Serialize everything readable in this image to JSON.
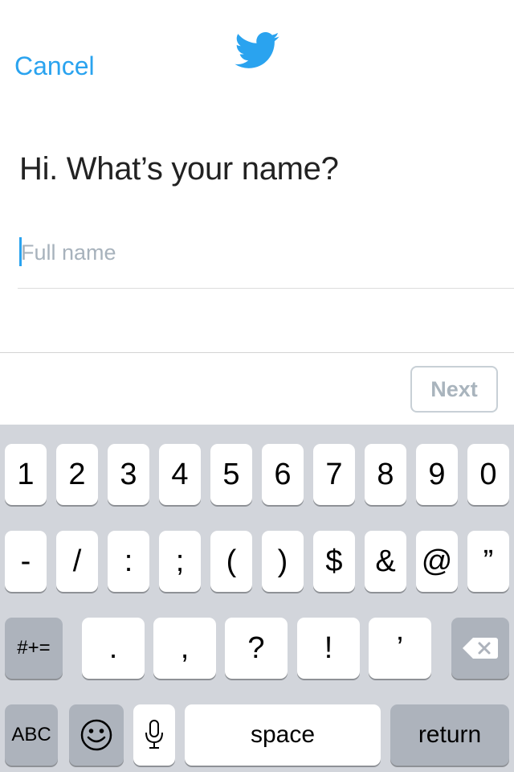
{
  "header": {
    "cancel_label": "Cancel",
    "logo_icon": "twitter-bird-icon",
    "accent_color": "#2aa3ef"
  },
  "main": {
    "heading": "Hi. What’s your name?",
    "name_placeholder": "Full name"
  },
  "action_bar": {
    "next_label": "Next"
  },
  "keyboard": {
    "row1": [
      "1",
      "2",
      "3",
      "4",
      "5",
      "6",
      "7",
      "8",
      "9",
      "0"
    ],
    "row2": [
      "-",
      "/",
      ":",
      ";",
      "(",
      ")",
      "$",
      "&",
      "@",
      "”"
    ],
    "row3": {
      "mode_label": "#+=",
      "keys": [
        ".",
        ",",
        "?",
        "!",
        "’"
      ],
      "backspace_icon": "backspace-icon"
    },
    "row4": {
      "abc_label": "ABC",
      "emoji_icon": "emoji-icon",
      "mic_icon": "microphone-icon",
      "space_label": "space",
      "return_label": "return"
    }
  }
}
